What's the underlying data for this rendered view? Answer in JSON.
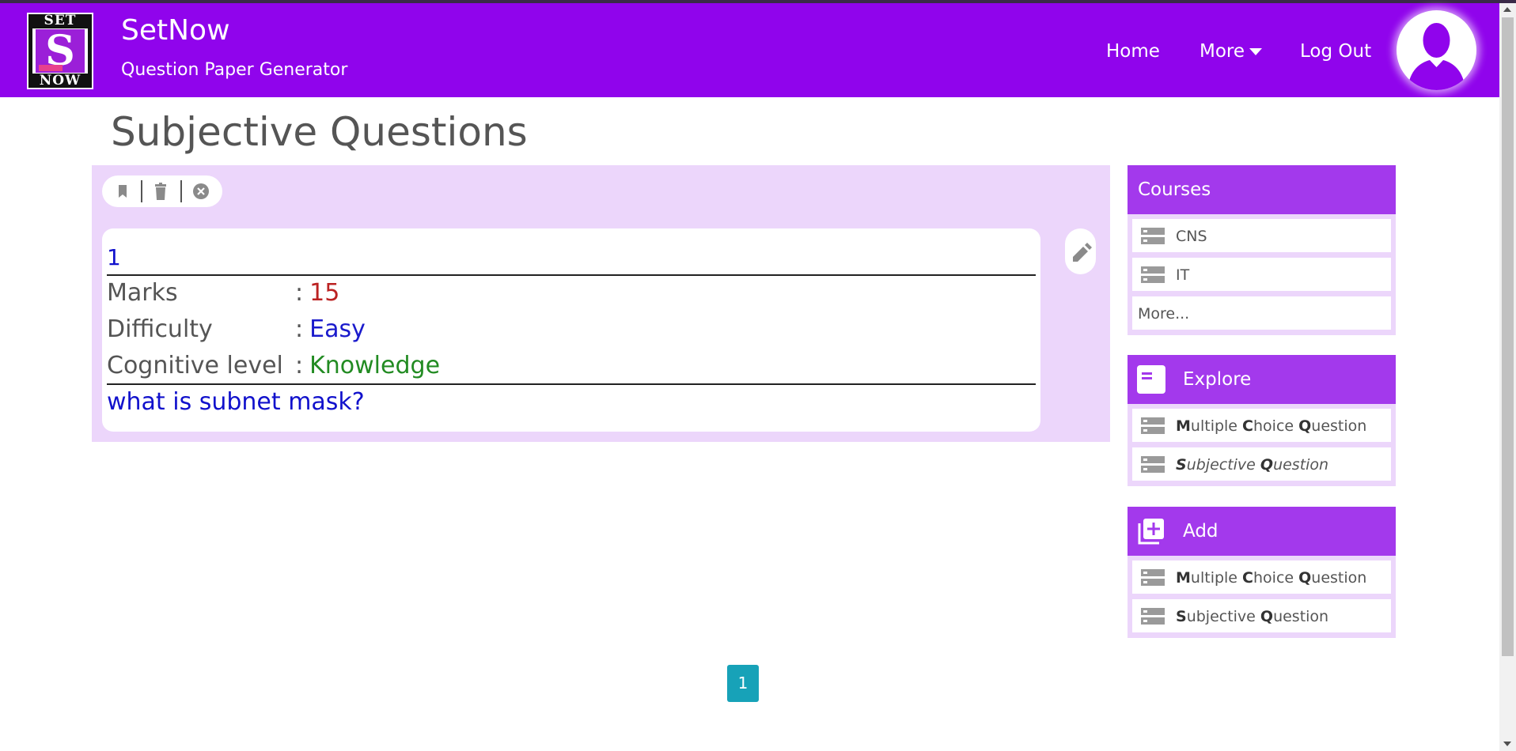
{
  "brand": {
    "logo_top": "SET",
    "logo_letter": "S",
    "logo_bottom": "NOW",
    "title": "SetNow",
    "subtitle": "Question Paper Generator"
  },
  "nav": {
    "home": "Home",
    "more": "More",
    "logout": "Log Out"
  },
  "page": {
    "title": "Subjective Questions"
  },
  "question": {
    "number": "1",
    "marks_label": "Marks",
    "marks_value": "15",
    "difficulty_label": "Difficulty",
    "difficulty_value": "Easy",
    "cognitive_label": "Cognitive level",
    "cognitive_value": "Knowledge",
    "separator": ":",
    "text": "what is subnet mask?"
  },
  "sidebar": {
    "courses": {
      "title": "Courses",
      "items": [
        "CNS",
        "IT"
      ],
      "more": "More..."
    },
    "explore": {
      "title": "Explore",
      "mcq": {
        "m": "M",
        "p1": "ultiple ",
        "c": "C",
        "p2": "hoice ",
        "q": "Q",
        "p3": "uestion"
      },
      "subjective": {
        "s": "S",
        "p1": "ubjective ",
        "q": "Q",
        "p2": "uestion"
      }
    },
    "add": {
      "title": "Add",
      "mcq": {
        "m": "M",
        "p1": "ultiple ",
        "c": "C",
        "p2": "hoice ",
        "q": "Q",
        "p3": "uestion"
      },
      "subjective": {
        "s": "S",
        "p1": "ubjective ",
        "q": "Q",
        "p2": "uestion"
      }
    }
  },
  "pagination": {
    "current": "1"
  },
  "colors": {
    "navbar": "#9004ec",
    "panel": "#ecd6fb",
    "side_head": "#a339ec",
    "page_button": "#17a2b8"
  }
}
